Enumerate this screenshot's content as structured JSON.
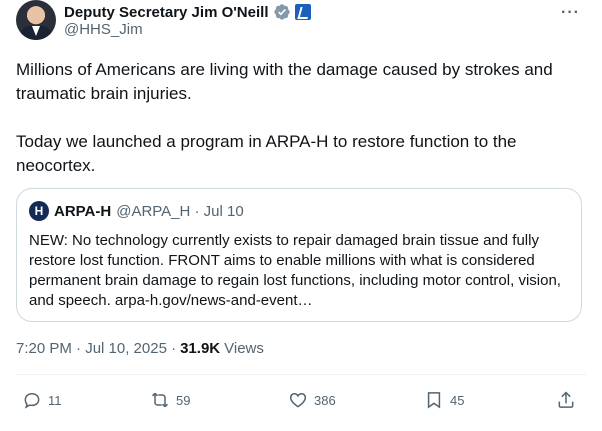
{
  "author": {
    "name": "Deputy Secretary Jim O'Neill",
    "handle": "@HHS_Jim"
  },
  "post": {
    "paragraph1": "Millions of Americans are living with the damage caused by strokes and traumatic brain injuries.",
    "paragraph2": "Today we launched a program in ARPA-H to restore function to the neocortex."
  },
  "quoted": {
    "logo_letter": "H",
    "name": "ARPA-H",
    "meta": "@ARPA_H · Jul 10",
    "text": "NEW: No technology currently exists to repair damaged brain tissue and fully restore lost function. FRONT aims to enable millions with what is considered permanent brain damage to regain lost functions, including motor control, vision, and speech. arpa-h.gov/news-and-event…"
  },
  "meta": {
    "timestamp": "7:20 PM · Jul 10, 2025 ·",
    "views_count": "31.9K",
    "views_label": "Views"
  },
  "actions": {
    "replies": "11",
    "reposts": "59",
    "likes": "386",
    "bookmarks": "45"
  },
  "icons": {
    "verified": "verified-badge-icon",
    "government": "government-badge-icon",
    "more": "more-icon",
    "reply": "reply-icon",
    "repost": "repost-icon",
    "like": "heart-icon",
    "bookmark": "bookmark-icon",
    "share": "share-icon"
  },
  "colors": {
    "text_primary": "#0f1419",
    "text_secondary": "#536471",
    "border": "#cfd9de",
    "verified_blue": "#1d9bf0",
    "gov_blue": "#1d5fbf"
  }
}
